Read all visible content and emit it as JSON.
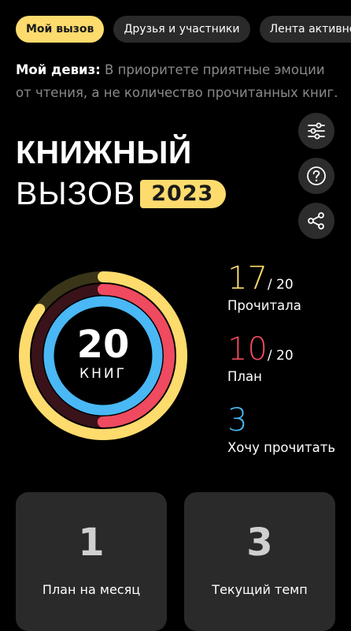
{
  "tabs": [
    {
      "label": "Мой вызов",
      "active": true
    },
    {
      "label": "Друзья и участники",
      "active": false
    },
    {
      "label": "Лента активнос",
      "active": false
    }
  ],
  "motto": {
    "label": "Мой девиз:",
    "text": " В приоритете приятные эмоции от чтения, а не количество прочитанных книг."
  },
  "side_icons": [
    "settings-sliders-icon",
    "help-icon",
    "share-icon"
  ],
  "heading": {
    "line1": "КНИЖНЫЙ",
    "line2": "ВЫЗОВ",
    "year": "2023"
  },
  "goal": {
    "number": "20",
    "label": "КНИГ"
  },
  "stats": [
    {
      "value": "17",
      "of": "/ 20",
      "label": "Прочитала",
      "color": "#fddb6d",
      "fraction": 0.85
    },
    {
      "value": "10",
      "of": "/ 20",
      "label": "План",
      "color": "#ef4a5f",
      "fraction": 0.5
    },
    {
      "value": "3",
      "of": "",
      "label": "Хочу прочитать",
      "color": "#49b8f5",
      "fraction": 1.0
    }
  ],
  "cards": [
    {
      "value": "1",
      "label": "План на месяц"
    },
    {
      "value": "3",
      "label": "Текущий темп"
    }
  ]
}
